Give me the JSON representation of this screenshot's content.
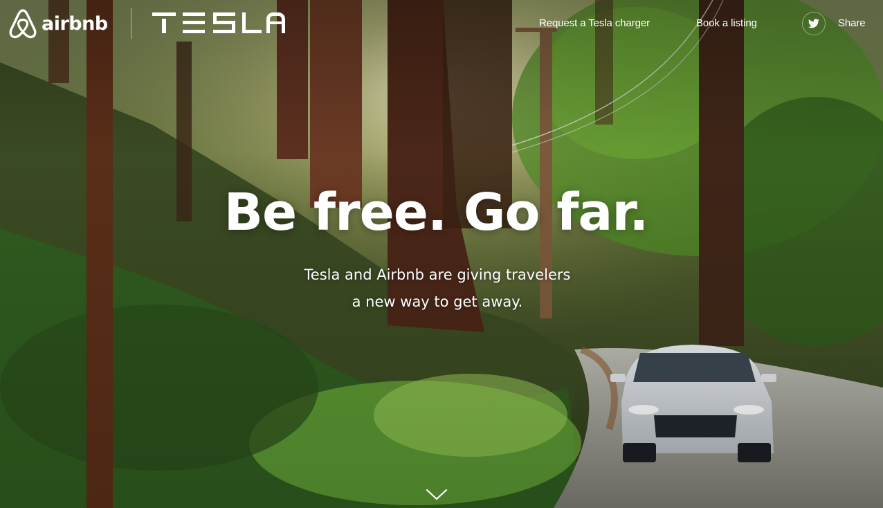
{
  "header": {
    "airbnb_logo_text": "airbnb",
    "tesla_logo_text": "TESLA",
    "nav": [
      {
        "label": "Request a Tesla charger"
      },
      {
        "label": "Book a listing"
      }
    ],
    "share_label": "Share"
  },
  "hero": {
    "headline": "Be free. Go far.",
    "subtitle_line1": "Tesla and Airbnb are giving travelers",
    "subtitle_line2": "a new way to get away."
  },
  "icons": {
    "airbnb": "airbnb-belo-icon",
    "twitter": "twitter-icon",
    "scroll": "chevron-down-icon"
  }
}
